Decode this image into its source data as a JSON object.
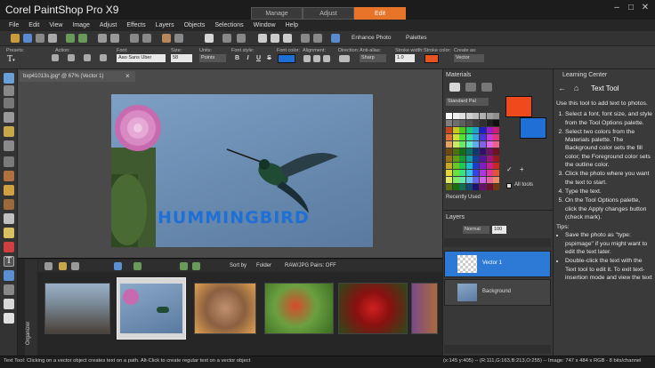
{
  "app": {
    "brand": "Corel PaintShop Pro X9",
    "workspace_tabs": [
      "Manage",
      "Adjust",
      "Edit"
    ],
    "active_tab": "Edit",
    "window_buttons": [
      "–",
      "□",
      "✕"
    ]
  },
  "menu": [
    "File",
    "Edit",
    "View",
    "Image",
    "Adjust",
    "Effects",
    "Layers",
    "Objects",
    "Selections",
    "Window",
    "Help"
  ],
  "toolbar": {
    "enhance_photo": "Enhance Photo",
    "palettes": "Palettes"
  },
  "tool_options": {
    "labels": {
      "presets": "Presets:",
      "action": "Action:",
      "font": "Font:",
      "size": "Size:",
      "units": "Units:",
      "font_style": "Font style:",
      "font_color": "Font color:",
      "alignment": "Alignment:",
      "direction": "Direction:",
      "anti_alias": "Anti-alias:",
      "stroke_width": "Stroke width:",
      "stroke_color": "Stroke color:",
      "create_as": "Create as:"
    },
    "font_value": "Aao Sans Uber",
    "size_value": "58",
    "units_value": "Points",
    "anti_alias_value": "Sharp",
    "stroke_width_value": "1.0",
    "create_as_value": "Vector",
    "style_buttons": [
      "B",
      "I",
      "U",
      "S"
    ],
    "font_color": "#1e6fd6",
    "stroke_color": "#e8541f"
  },
  "document": {
    "tab_title": "bxp41013s.jpg* @  67% (Vector 1)",
    "overlay_text": "HUMMINGBIRD"
  },
  "organizer": {
    "side_label": "Organizer",
    "sort_by": "Sort by",
    "folder": "Folder",
    "raw_pairs": "RAW/JPG Pairs: OFF"
  },
  "materials": {
    "title": "Materials",
    "palette_select": "Standard Pal",
    "recently_used": "Recently Used",
    "all_tools": "All tools",
    "fore_color": "#f04a1c",
    "back_color": "#1e6fd6"
  },
  "layers": {
    "title": "Layers",
    "blend_mode": "Normal",
    "opacity": "100",
    "items": [
      {
        "name": "Vector 1"
      },
      {
        "name": "Background"
      }
    ]
  },
  "learning_center": {
    "panel_title": "Learning Center",
    "heading": "Text Tool",
    "intro": "Use this tool to add text to photos.",
    "steps": [
      "Select a font, font size, and style from the Tool Options palette.",
      "Select two colors from the Materials palette. The Background color sets the fill color; the Foreground color sets the outline color.",
      "Click the photo where you want the text to start.",
      "Type the text.",
      "On the Tool Options palette, click the Apply changes button (check mark)."
    ],
    "tips_label": "Tips:",
    "tips": [
      "Save the photo as \"type: pspimage\" if you might want to edit the text later.",
      "Double-click the text with the Text tool to edit it. To exit text-insertion mode and view the text"
    ]
  },
  "status": {
    "message": "Text Tool: Clicking on a vector object creates text on a path. Alt-Click to create regular text on a vector object",
    "coords": "(x:145 y:405) -- (R:111,G:163,B:213,O:255) -- Image: 747 x 484 x RGB - 8 bits/channel"
  }
}
